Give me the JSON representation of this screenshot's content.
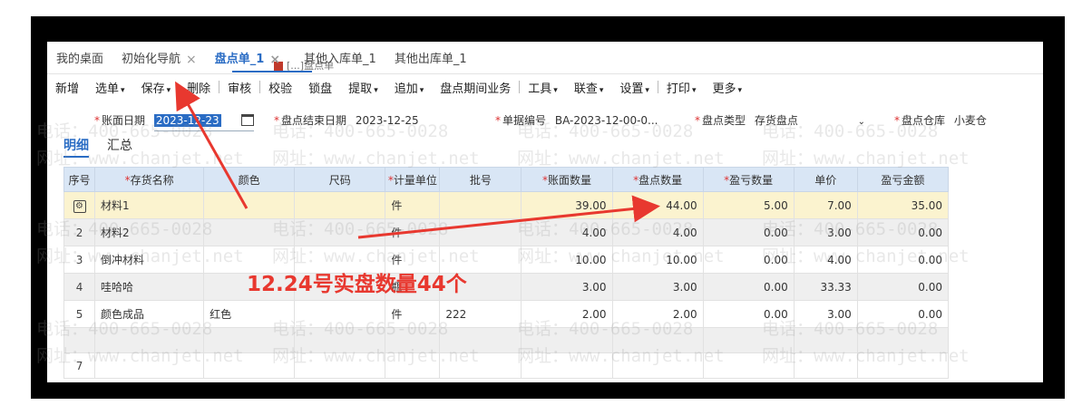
{
  "window": {
    "partial_title": "[...]盘点单"
  },
  "tabs": [
    {
      "label": "我的桌面",
      "closable": false,
      "active": false
    },
    {
      "label": "初始化导航",
      "closable": true,
      "active": false
    },
    {
      "label": "盘点单_1",
      "closable": true,
      "active": true
    },
    {
      "label": "其他入库单_1",
      "closable": false,
      "active": false
    },
    {
      "label": "其他出库单_1",
      "closable": false,
      "active": false
    }
  ],
  "toolbar": [
    {
      "label": "新增",
      "dropdown": false
    },
    {
      "label": "选单",
      "dropdown": true
    },
    {
      "label": "保存",
      "dropdown": true
    },
    {
      "label": "删除",
      "dropdown": false,
      "sep_after": true
    },
    {
      "label": "审核",
      "dropdown": false,
      "sep_after": true
    },
    {
      "label": "校验",
      "dropdown": false
    },
    {
      "label": "锁盘",
      "dropdown": false
    },
    {
      "label": "提取",
      "dropdown": true
    },
    {
      "label": "追加",
      "dropdown": true
    },
    {
      "label": "盘点期间业务",
      "dropdown": false,
      "sep_after": true
    },
    {
      "label": "工具",
      "dropdown": true
    },
    {
      "label": "联查",
      "dropdown": true
    },
    {
      "label": "设置",
      "dropdown": true,
      "sep_after": true
    },
    {
      "label": "打印",
      "dropdown": true
    },
    {
      "label": "更多",
      "dropdown": true
    }
  ],
  "form": {
    "book_date_label": "账面日期",
    "book_date_value": "2023-12-23",
    "end_date_label": "盘点结束日期",
    "end_date_value": "2023-12-25",
    "doc_no_label": "单据编号",
    "doc_no_value": "BA-2023-12-00-0...",
    "type_label": "盘点类型",
    "type_value": "存货盘点",
    "warehouse_label": "盘点仓库",
    "warehouse_value": "小麦仓"
  },
  "subtabs": [
    {
      "label": "明细",
      "active": true
    },
    {
      "label": "汇总",
      "active": false
    }
  ],
  "grid": {
    "columns": [
      {
        "label": "序号",
        "required": false
      },
      {
        "label": "存货名称",
        "required": true
      },
      {
        "label": "颜色",
        "required": false
      },
      {
        "label": "尺码",
        "required": false
      },
      {
        "label": "计量单位",
        "required": true
      },
      {
        "label": "批号",
        "required": false
      },
      {
        "label": "账面数量",
        "required": true
      },
      {
        "label": "盘点数量",
        "required": true
      },
      {
        "label": "盈亏数量",
        "required": true
      },
      {
        "label": "单价",
        "required": false
      },
      {
        "label": "盈亏金额",
        "required": false
      }
    ],
    "rows": [
      {
        "idx": "",
        "name": "材料1",
        "color": "",
        "size": "",
        "unit": "件",
        "batch": "",
        "book_qty": "39.00",
        "count_qty": "44.00",
        "diff_qty": "5.00",
        "price": "7.00",
        "diff_amt": "35.00",
        "selected": true
      },
      {
        "idx": "2",
        "name": "材料2",
        "color": "",
        "size": "",
        "unit": "件",
        "batch": "",
        "book_qty": "4.00",
        "count_qty": "4.00",
        "diff_qty": "0.00",
        "price": "3.00",
        "diff_amt": "0.00"
      },
      {
        "idx": "3",
        "name": "倒冲材料",
        "color": "",
        "size": "",
        "unit": "件",
        "batch": "",
        "book_qty": "10.00",
        "count_qty": "10.00",
        "diff_qty": "0.00",
        "price": "4.00",
        "diff_amt": "0.00"
      },
      {
        "idx": "4",
        "name": "哇哈哈",
        "color": "",
        "size": "",
        "unit": "瓶",
        "batch": "",
        "book_qty": "3.00",
        "count_qty": "3.00",
        "diff_qty": "0.00",
        "price": "33.33",
        "diff_amt": "0.00"
      },
      {
        "idx": "5",
        "name": "颜色成品",
        "color": "红色",
        "size": "",
        "unit": "件",
        "batch": "222",
        "book_qty": "2.00",
        "count_qty": "2.00",
        "diff_qty": "0.00",
        "price": "3.00",
        "diff_amt": "0.00"
      },
      {
        "idx": "",
        "empty": true
      },
      {
        "idx": "7",
        "empty": true
      }
    ]
  },
  "annotation": {
    "text": "12.24号实盘数量44个",
    "color": "#e8382f"
  },
  "watermark": {
    "phone": "电话：400-665-0028",
    "site": "网址：www.chanjet.net"
  },
  "colors": {
    "accent": "#2a6cc4",
    "header_bg": "#d9e6f5",
    "selected_row": "#fbf3cf",
    "required": "#dd3333"
  }
}
